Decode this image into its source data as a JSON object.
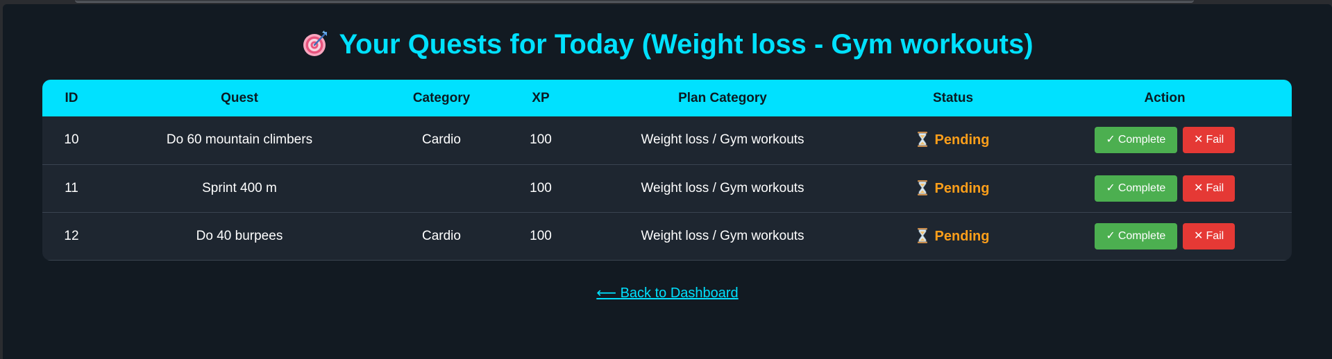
{
  "page": {
    "title_text": "Your Quests for Today (Weight loss - Gym workouts)",
    "title_icon": "target-icon"
  },
  "table": {
    "headers": {
      "id": "ID",
      "quest": "Quest",
      "category": "Category",
      "xp": "XP",
      "plan_category": "Plan Category",
      "status": "Status",
      "action": "Action"
    },
    "rows": [
      {
        "id": "10",
        "quest": "Do 60 mountain climbers",
        "category": "Cardio",
        "xp": "100",
        "plan_category": "Weight loss / Gym workouts",
        "status_icon": "hourglass-icon",
        "status": "Pending",
        "complete_label": "Complete",
        "fail_label": "Fail"
      },
      {
        "id": "11",
        "quest": "Sprint 400 m",
        "category": "",
        "xp": "100",
        "plan_category": "Weight loss / Gym workouts",
        "status_icon": "hourglass-icon",
        "status": "Pending",
        "complete_label": "Complete",
        "fail_label": "Fail"
      },
      {
        "id": "12",
        "quest": "Do 40 burpees",
        "category": "Cardio",
        "xp": "100",
        "plan_category": "Weight loss / Gym workouts",
        "status_icon": "hourglass-icon",
        "status": "Pending",
        "complete_label": "Complete",
        "fail_label": "Fail"
      }
    ]
  },
  "glyphs": {
    "check": "✓",
    "cross": "✕",
    "arrow": "⟵"
  },
  "footer": {
    "back_link_label": "Back to Dashboard"
  },
  "colors": {
    "accent": "#00e1ff",
    "background": "#121a22",
    "row_background": "#1e2630",
    "pending": "#ff9f1a",
    "complete_button": "#4caf50",
    "fail_button": "#e53935"
  }
}
